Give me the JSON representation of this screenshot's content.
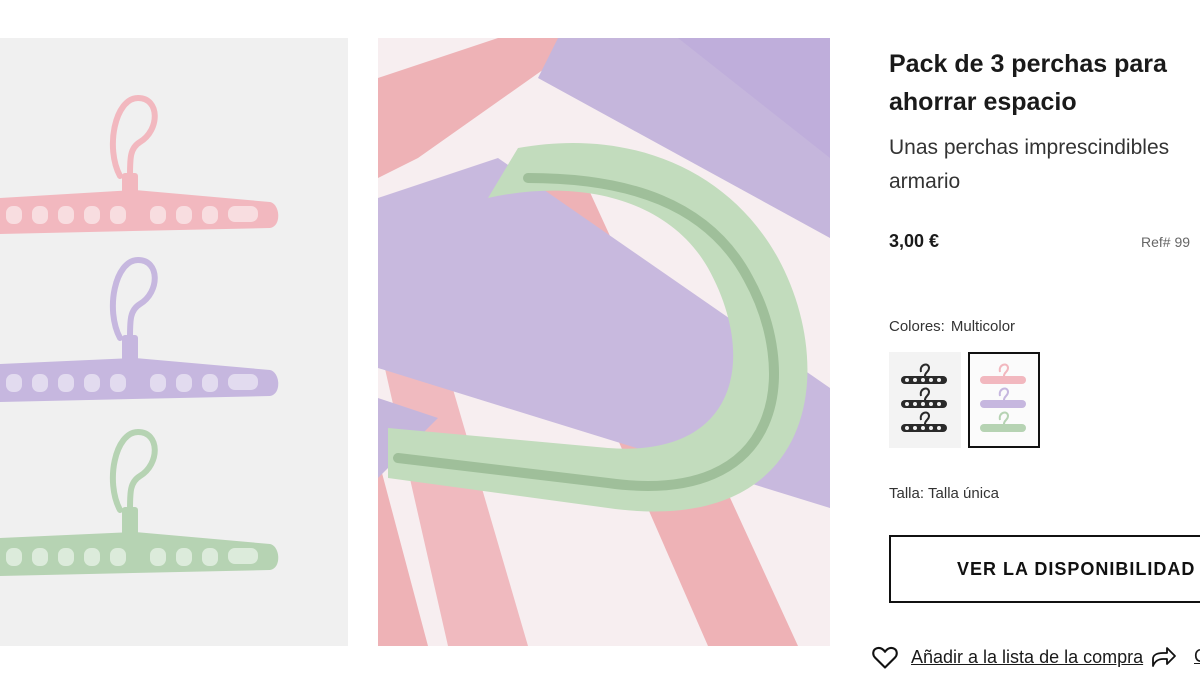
{
  "product": {
    "title": "Pack de 3 perchas para\nahorrar espacio",
    "subtitle": "Unas perchas imprescindibles\narmario",
    "price": "3,00 €",
    "ref": "Ref# 99"
  },
  "colors": {
    "label": "Colores:",
    "value": "Multicolor",
    "options": [
      "black",
      "multicolor"
    ],
    "selected": "multicolor"
  },
  "size": {
    "label": "Talla:",
    "value": "Talla única"
  },
  "actions": {
    "availability_button": "VER LA DISPONIBILIDAD",
    "wishlist_link": "Añadir a la lista de la compra",
    "share_link": "C"
  },
  "palette": {
    "pink": "#f2b8bf",
    "lilac": "#c6b7df",
    "mint": "#b6d3b3",
    "black": "#2a2a2a"
  },
  "icons": [
    "heart-icon",
    "share-icon"
  ]
}
